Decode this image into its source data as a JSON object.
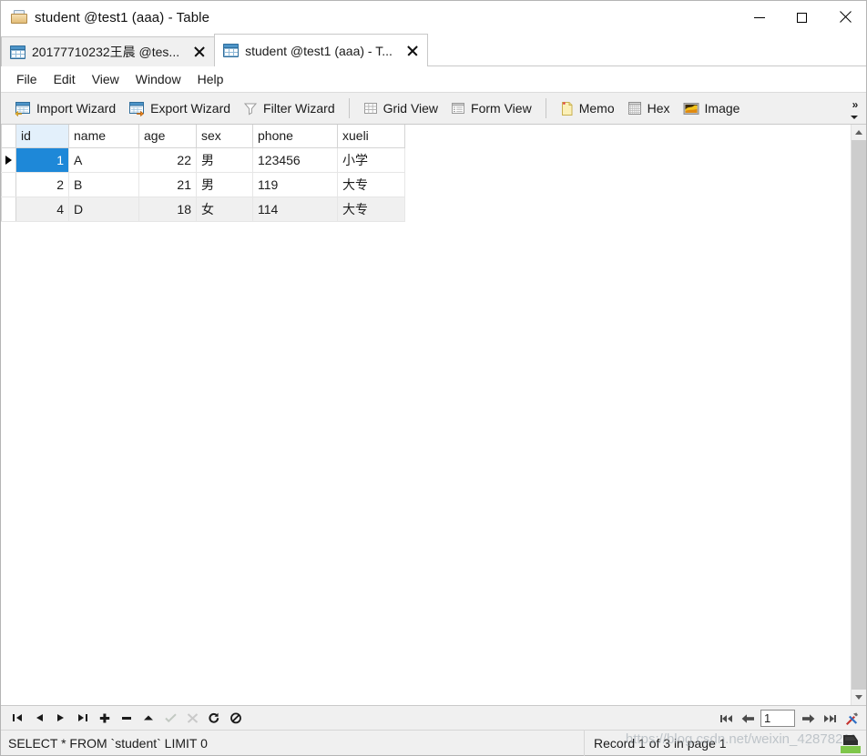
{
  "window": {
    "title": "student @test1 (aaa) - Table",
    "icon": "table-window-icon",
    "controls": {
      "minimize": "minimize-button",
      "maximize": "maximize-button",
      "close": "close-button"
    }
  },
  "tabs": [
    {
      "label": "20177710232王晨 @tes...",
      "active": false,
      "close": "×"
    },
    {
      "label": "student @test1 (aaa) - T...",
      "active": true,
      "close": "×"
    }
  ],
  "menubar": {
    "items": [
      {
        "label": "File"
      },
      {
        "label": "Edit"
      },
      {
        "label": "View"
      },
      {
        "label": "Window"
      },
      {
        "label": "Help"
      }
    ]
  },
  "toolbar": {
    "import_wizard": "Import Wizard",
    "export_wizard": "Export Wizard",
    "filter_wizard": "Filter Wizard",
    "grid_view": "Grid View",
    "form_view": "Form View",
    "memo": "Memo",
    "hex": "Hex",
    "image": "Image",
    "overflow": "»"
  },
  "grid": {
    "columns": [
      "id",
      "name",
      "age",
      "sex",
      "phone",
      "xueli"
    ],
    "key_column": "id",
    "rows": [
      {
        "id": "1",
        "name": "A",
        "age": "22",
        "sex": "男",
        "phone": "123456",
        "xueli": "小学",
        "selected": true
      },
      {
        "id": "2",
        "name": "B",
        "age": "21",
        "sex": "男",
        "phone": "119",
        "xueli": "大专",
        "selected": false
      },
      {
        "id": "4",
        "name": "D",
        "age": "18",
        "sex": "女",
        "phone": "114",
        "xueli": "大专",
        "selected": false
      }
    ]
  },
  "navbar": {
    "buttons": [
      {
        "name": "first-record-button",
        "enabled": true
      },
      {
        "name": "previous-record-button",
        "enabled": true
      },
      {
        "name": "next-record-button",
        "enabled": true
      },
      {
        "name": "last-record-button",
        "enabled": true
      },
      {
        "name": "add-record-button",
        "enabled": true
      },
      {
        "name": "delete-record-button",
        "enabled": true
      },
      {
        "name": "apply-change-button",
        "enabled": true
      },
      {
        "name": "confirm-button",
        "enabled": false
      },
      {
        "name": "cancel-edit-button",
        "enabled": false
      },
      {
        "name": "refresh-button",
        "enabled": true
      },
      {
        "name": "stop-button",
        "enabled": true
      }
    ],
    "page_value": "1",
    "page_buttons": [
      {
        "name": "first-page-button"
      },
      {
        "name": "previous-page-button"
      },
      {
        "name": "next-page-button"
      },
      {
        "name": "last-page-button"
      },
      {
        "name": "tools-button"
      }
    ]
  },
  "statusbar": {
    "sql": "SELECT * FROM `student` LIMIT 0",
    "record_info": "Record 1 of 3 in page 1",
    "watermark": "https://blog.csdn.net/weixin_42878211"
  },
  "colors": {
    "selection": "#1e88d8",
    "key_header": "#e3f0fb",
    "toolbar_bg": "#f0f0f0",
    "alt_row": "#f0f0f0"
  }
}
